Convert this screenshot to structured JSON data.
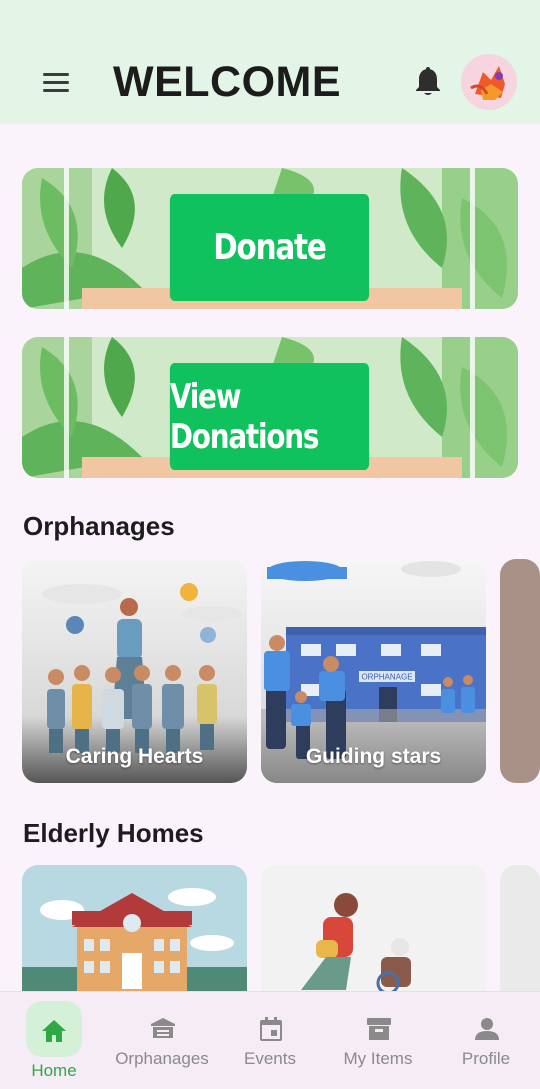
{
  "header": {
    "title": "WELCOME"
  },
  "banners": [
    {
      "label": "Donate"
    },
    {
      "label": "View Donations"
    }
  ],
  "orphanages": {
    "title": "Orphanages",
    "cards": [
      {
        "name": "Caring Hearts"
      },
      {
        "name": "Guiding stars"
      }
    ],
    "building_sign": "ORPHANAGE"
  },
  "elderly_homes": {
    "title": "Elderly Homes"
  },
  "bottom_nav": {
    "items": [
      {
        "label": "Home",
        "icon": "home-icon",
        "active": true
      },
      {
        "label": "Orphanages",
        "icon": "building-icon",
        "active": false
      },
      {
        "label": "Events",
        "icon": "calendar-icon",
        "active": false
      },
      {
        "label": "My Items",
        "icon": "archive-icon",
        "active": false
      },
      {
        "label": "Profile",
        "icon": "person-icon",
        "active": false
      }
    ]
  },
  "colors": {
    "header_bg": "#e2f5e6",
    "page_bg": "#fbf3fb",
    "accent_green": "#0fc25e",
    "nav_active": "#2fa846",
    "nav_active_pill": "#d4f1d7"
  }
}
